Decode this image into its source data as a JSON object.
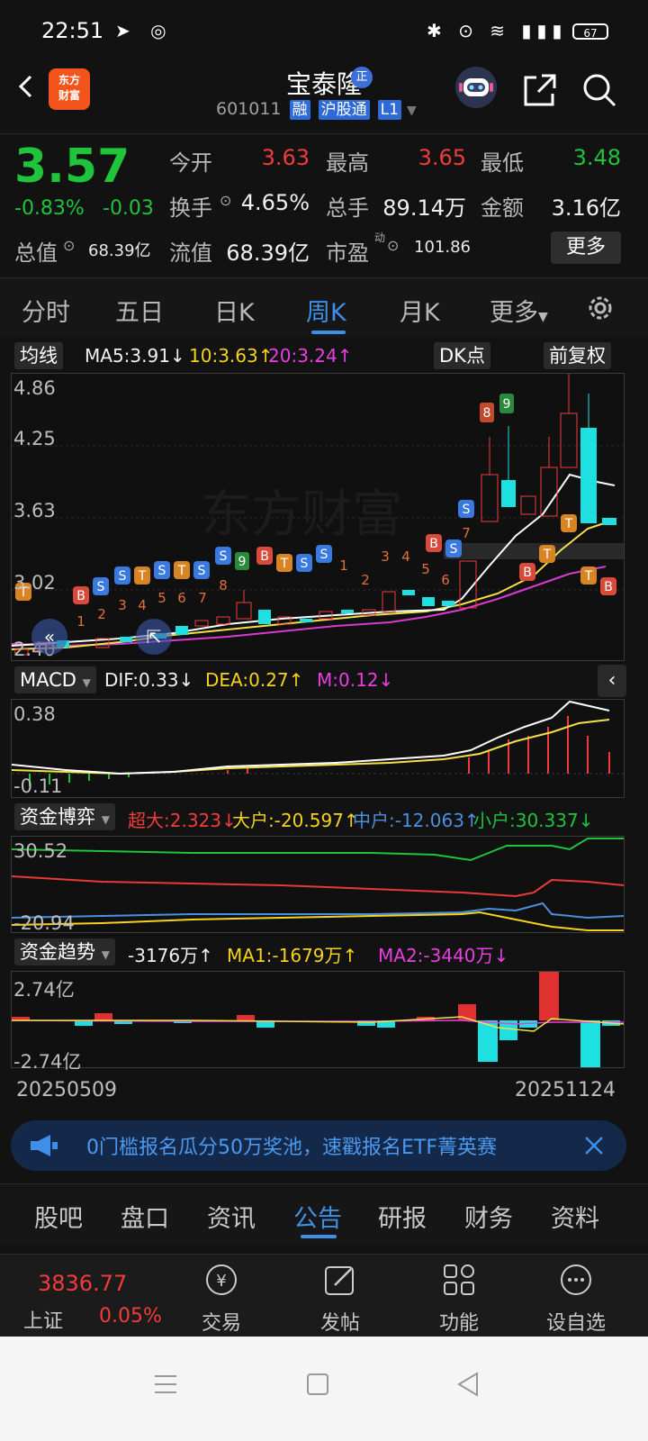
{
  "status_bar": {
    "time": "22:51",
    "battery": "67",
    "icons": [
      "telegram-icon",
      "shield-icon",
      "bluetooth-icon",
      "location-icon",
      "wifi-icon",
      "lte-icon",
      "signal-icon",
      "battery-icon"
    ]
  },
  "header": {
    "logo_line1": "东方",
    "logo_line2": "财富",
    "stock_name": "宝泰隆",
    "name_badge": "正",
    "code": "601011",
    "tags": [
      "融",
      "沪股通",
      "L1"
    ]
  },
  "quote": {
    "price": "3.57",
    "change_pct": "-0.83%",
    "change_amt": "-0.03",
    "open_label": "今开",
    "open": "3.63",
    "high_label": "最高",
    "high": "3.65",
    "low_label": "最低",
    "low": "3.48",
    "turnover_label": "换手",
    "turnover": "4.65%",
    "volume_label": "总手",
    "volume": "89.14万",
    "amount_label": "金额",
    "amount": "3.16亿",
    "mktcap_label": "总值",
    "mktcap": "68.39亿",
    "float_label": "流值",
    "float": "68.39亿",
    "pe_label": "市盈",
    "pe_sup": "动",
    "pe": "101.86",
    "more_label": "更多"
  },
  "period_tabs": [
    {
      "label": "分时"
    },
    {
      "label": "五日"
    },
    {
      "label": "日K"
    },
    {
      "label": "周K"
    },
    {
      "label": "月K"
    },
    {
      "label": "更多"
    }
  ],
  "main_chart": {
    "indicator": "均线",
    "ma5": "MA5:3.91↓",
    "ma10": "10:3.63↑",
    "ma20": "20:3.24↑",
    "dk_label": "DK点",
    "adjust_label": "前复权",
    "y_ticks": [
      "4.86",
      "4.25",
      "3.63",
      "3.02",
      "2.40"
    ],
    "watermark": "东方财富"
  },
  "macd": {
    "indicator": "MACD",
    "dif": "DIF:0.33↓",
    "dea": "DEA:0.27↑",
    "m": "M:0.12↓",
    "y_top": "0.38",
    "y_bottom": "-0.11"
  },
  "fund_game": {
    "indicator": "资金博弈",
    "super": "超大:2.323↓",
    "large": "大户:-20.597↑",
    "medium": "中户:-12.063↑",
    "small": "小户:30.337↓",
    "y_top": "30.52",
    "y_bottom": "-20.94"
  },
  "fund_trend": {
    "indicator": "资金趋势",
    "value": "-3176万↑",
    "ma1": "MA1:-1679万↑",
    "ma2": "MA2:-3440万↓",
    "y_top": "2.74亿",
    "y_bottom": "-2.74亿",
    "date_start": "20250509",
    "date_end": "20251124"
  },
  "banner": {
    "text": "0门槛报名瓜分50万奖池，速戳报名ETF菁英赛"
  },
  "bottom_tabs": [
    {
      "label": "股吧"
    },
    {
      "label": "盘口"
    },
    {
      "label": "资讯"
    },
    {
      "label": "公告"
    },
    {
      "label": "研报"
    },
    {
      "label": "财务"
    },
    {
      "label": "资料"
    }
  ],
  "bottom_nav": {
    "index_value": "3836.77",
    "index_name": "上证",
    "index_change": "0.05%",
    "trade": "交易",
    "post": "发帖",
    "function": "功能",
    "watchlist": "设自选"
  }
}
